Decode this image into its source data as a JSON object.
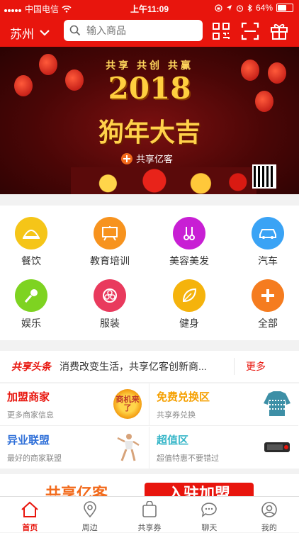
{
  "status_bar": {
    "carrier": "中国电信",
    "time": "上午11:09",
    "battery": "64%",
    "battery_level": 0.64
  },
  "header": {
    "city": "苏州",
    "search_placeholder": "输入商品"
  },
  "banner": {
    "top_text": "共享 共创 共赢",
    "year": "2018",
    "blessing": "狗年大吉",
    "brand": "共享亿客"
  },
  "categories": [
    {
      "label": "餐饮",
      "color": "#f5c518",
      "icon": "dish-cover-icon"
    },
    {
      "label": "教育培训",
      "color": "#f7931e",
      "icon": "blackboard-icon"
    },
    {
      "label": "美容美发",
      "color": "#c81fd4",
      "icon": "scissors-comb-icon"
    },
    {
      "label": "汽车",
      "color": "#3aa3f5",
      "icon": "car-icon"
    },
    {
      "label": "娱乐",
      "color": "#7ed321",
      "icon": "microphone-icon"
    },
    {
      "label": "服装",
      "color": "#e93a5d",
      "icon": "clothing-icon"
    },
    {
      "label": "健身",
      "color": "#f5b30c",
      "icon": "leaf-icon"
    },
    {
      "label": "全部",
      "color": "#f57c1f",
      "icon": "plus-icon"
    }
  ],
  "news": {
    "tag": "共享头条",
    "text": "消费改变生活，共享亿客创新商...",
    "more": "更多"
  },
  "promo": [
    {
      "title": "加盟商家",
      "subtitle": "更多商家信息",
      "color": "#e8150d",
      "pic_text": "商机来了"
    },
    {
      "title": "免费兑换区",
      "subtitle": "共享券兑换",
      "color": "#f5a000"
    },
    {
      "title": "异业联盟",
      "subtitle": "最好的商家联盟",
      "color": "#2f6fd8"
    },
    {
      "title": "超值区",
      "subtitle": "超值特惠不要错过",
      "color": "#36b6c8"
    }
  ],
  "ad": {
    "logo": "共享亿客",
    "button": "入驻加盟"
  },
  "tabs": [
    {
      "label": "首页",
      "icon": "home-icon",
      "active": true
    },
    {
      "label": "周边",
      "icon": "location-pin-icon"
    },
    {
      "label": "共享券",
      "icon": "coupon-bag-icon"
    },
    {
      "label": "聊天",
      "icon": "chat-bubble-icon"
    },
    {
      "label": "我的",
      "icon": "user-icon"
    }
  ]
}
